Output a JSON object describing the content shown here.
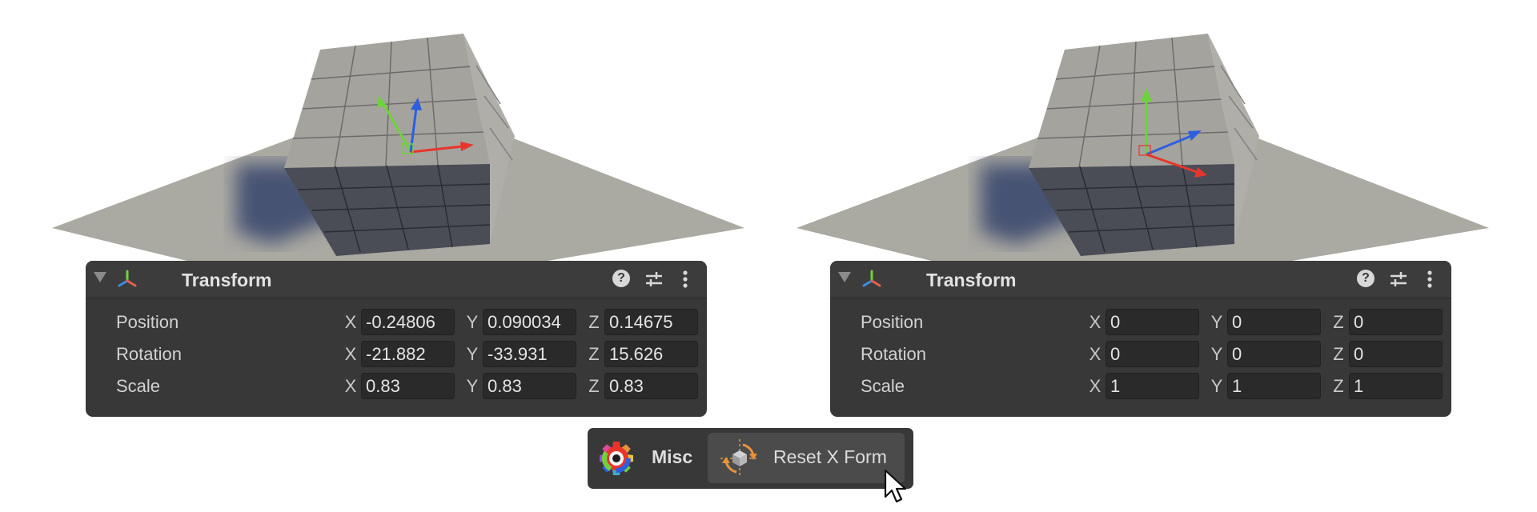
{
  "panels": [
    {
      "title": "Transform",
      "rows": [
        {
          "label": "Position",
          "x": "-0.24806",
          "y": "0.090034",
          "z": "0.14675"
        },
        {
          "label": "Rotation",
          "x": "-21.882",
          "y": "-33.931",
          "z": "15.626"
        },
        {
          "label": "Scale",
          "x": "0.83",
          "y": "0.83",
          "z": "0.83"
        }
      ]
    },
    {
      "title": "Transform",
      "rows": [
        {
          "label": "Position",
          "x": "0",
          "y": "0",
          "z": "0"
        },
        {
          "label": "Rotation",
          "x": "0",
          "y": "0",
          "z": "0"
        },
        {
          "label": "Scale",
          "x": "1",
          "y": "1",
          "z": "1"
        }
      ]
    }
  ],
  "axes": {
    "x": "X",
    "y": "Y",
    "z": "Z"
  },
  "icons": {
    "foldout": "triangle-down-icon",
    "transform": "transform-axes-icon",
    "help": "question-mark-icon",
    "presets": "sliders-icon",
    "menu": "kebab-menu-icon",
    "misc": "gear-icon",
    "reset": "reset-transform-icon",
    "cursor": "mouse-pointer-icon"
  },
  "help_glyph": "?",
  "toolbar": {
    "category_label": "Misc",
    "reset_label": "Reset X Form"
  },
  "colors": {
    "panel_bg": "#383838",
    "field_bg": "#2a2a2a",
    "accent_orange": "#e8923a",
    "axis_red": "#e8352b",
    "axis_green": "#6fd23c",
    "axis_blue": "#2e5fe0"
  }
}
